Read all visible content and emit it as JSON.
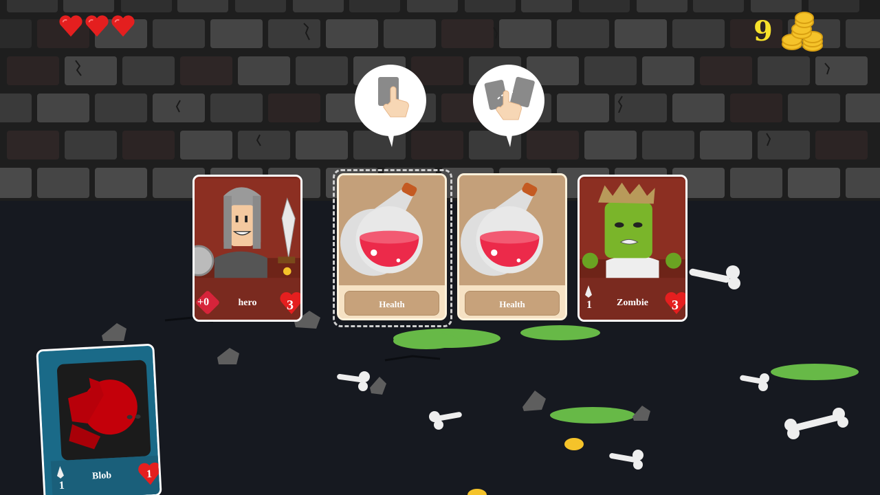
{
  "hud": {
    "hearts": 3,
    "coins": "9",
    "heart_color": "#e41f1f",
    "coin_color": "#f7e12b"
  },
  "hints": [
    {
      "icon": "tap-card-icon"
    },
    {
      "icon": "drag-card-icon"
    }
  ],
  "cards": {
    "hero": {
      "name": "hero",
      "attack": "+0",
      "health": "3"
    },
    "potion1": {
      "name": "Health"
    },
    "potion2": {
      "name": "Health"
    },
    "zombie": {
      "name": "Zombie",
      "attack": "1",
      "health": "3"
    }
  },
  "hand": {
    "blob": {
      "name": "Blob",
      "attack": "1",
      "health": "1"
    }
  },
  "colors": {
    "wall_dark": "#262626",
    "brick": "#3d3d3d",
    "floor": "#161920",
    "card_red": "#7a2a1f",
    "card_teal": "#1a6a88",
    "potion_bg": "#c4a07a",
    "slime": "#6cc24a"
  }
}
